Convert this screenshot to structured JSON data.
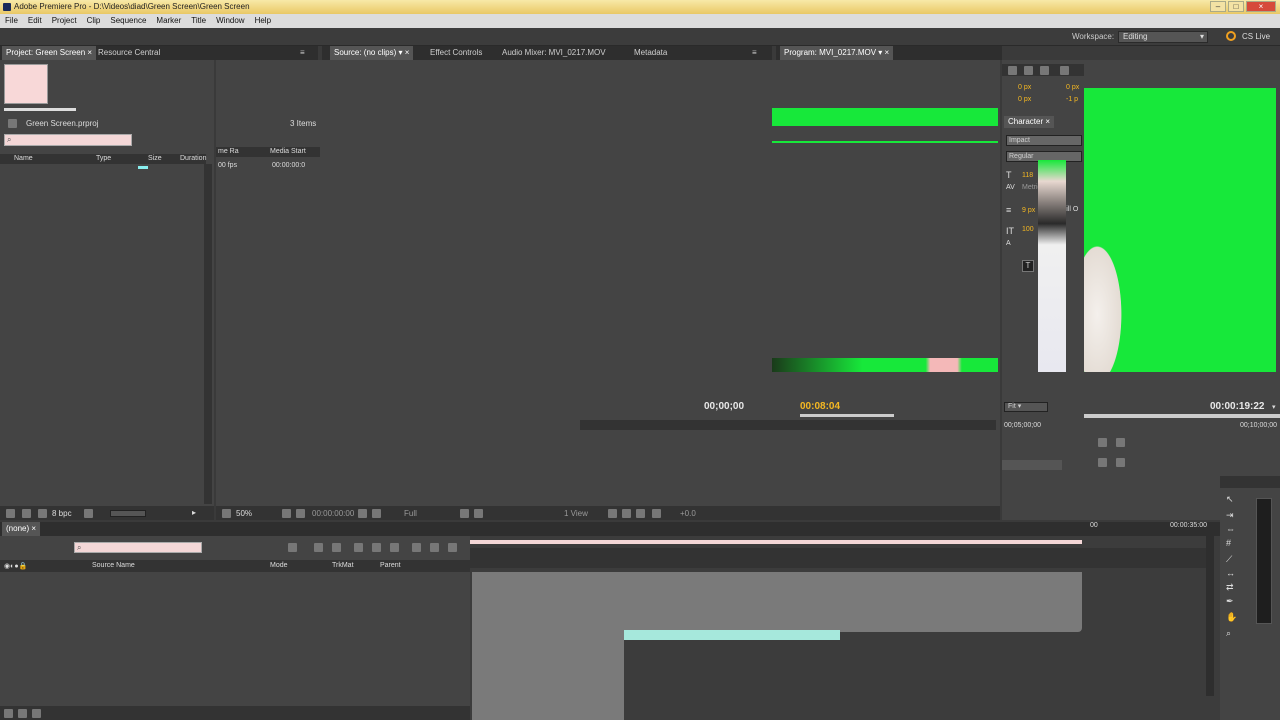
{
  "app": {
    "title": "Adobe Premiere Pro - D:\\Videos\\diad\\Green Screen\\Green Screen"
  },
  "menu": [
    "File",
    "Edit",
    "Project",
    "Clip",
    "Sequence",
    "Marker",
    "Title",
    "Window",
    "Help"
  ],
  "toolbar": {
    "workspace_label": "Workspace:",
    "workspace_value": "Editing",
    "cslive": "CS Live"
  },
  "project_panel": {
    "tabs": [
      "Project: Green Screen",
      "Resource Central"
    ],
    "project_file": "Green Screen.prproj",
    "items_count": "3 Items",
    "columns": [
      "Name",
      "Type",
      "Size",
      "Duration"
    ],
    "bit_depth": "8 bpc"
  },
  "source_panel": {
    "tabs": [
      "Source: (no clips)",
      "Effect Controls",
      "Audio Mixer: MVI_0217.MOV",
      "Metadata"
    ],
    "columns": [
      "me Ra",
      "Media Start"
    ],
    "row_values": [
      "00 fps",
      "00:00:00:0"
    ],
    "timecode_start": "00;00;00",
    "zoom": "50%",
    "tc_display": "00:00:00:00",
    "quality": "Full",
    "view": "1 View",
    "offset": "+0.0"
  },
  "program_panel": {
    "tabs": [
      "Program: MVI_0217.MOV"
    ],
    "timecode_current": "00:08:04",
    "timecode_duration": "00:00:19:22",
    "fit": "Fit",
    "ruler_start": "00;05;00;00",
    "ruler_end": "00;10;00;00"
  },
  "character_panel": {
    "tab": "Character",
    "font": "Impact",
    "style": "Regular",
    "size": "118",
    "metrics": "Metrics",
    "tracking": "9 px",
    "leading": "100",
    "px_top1": "0 px",
    "px_top2": "0 px",
    "px_top3": "0 px",
    "px_top4": "-1 p",
    "fill_label": "Fill O"
  },
  "timeline": {
    "tab": "(none)",
    "headers": [
      "Source Name",
      "Mode",
      "TrkMat",
      "Parent"
    ],
    "timecode_end": "00:00:35:00",
    "timecode_left": "00"
  },
  "colors": {
    "accent": "#f5b822",
    "green_screen": "#17e83a",
    "panel_bg": "#444444"
  }
}
